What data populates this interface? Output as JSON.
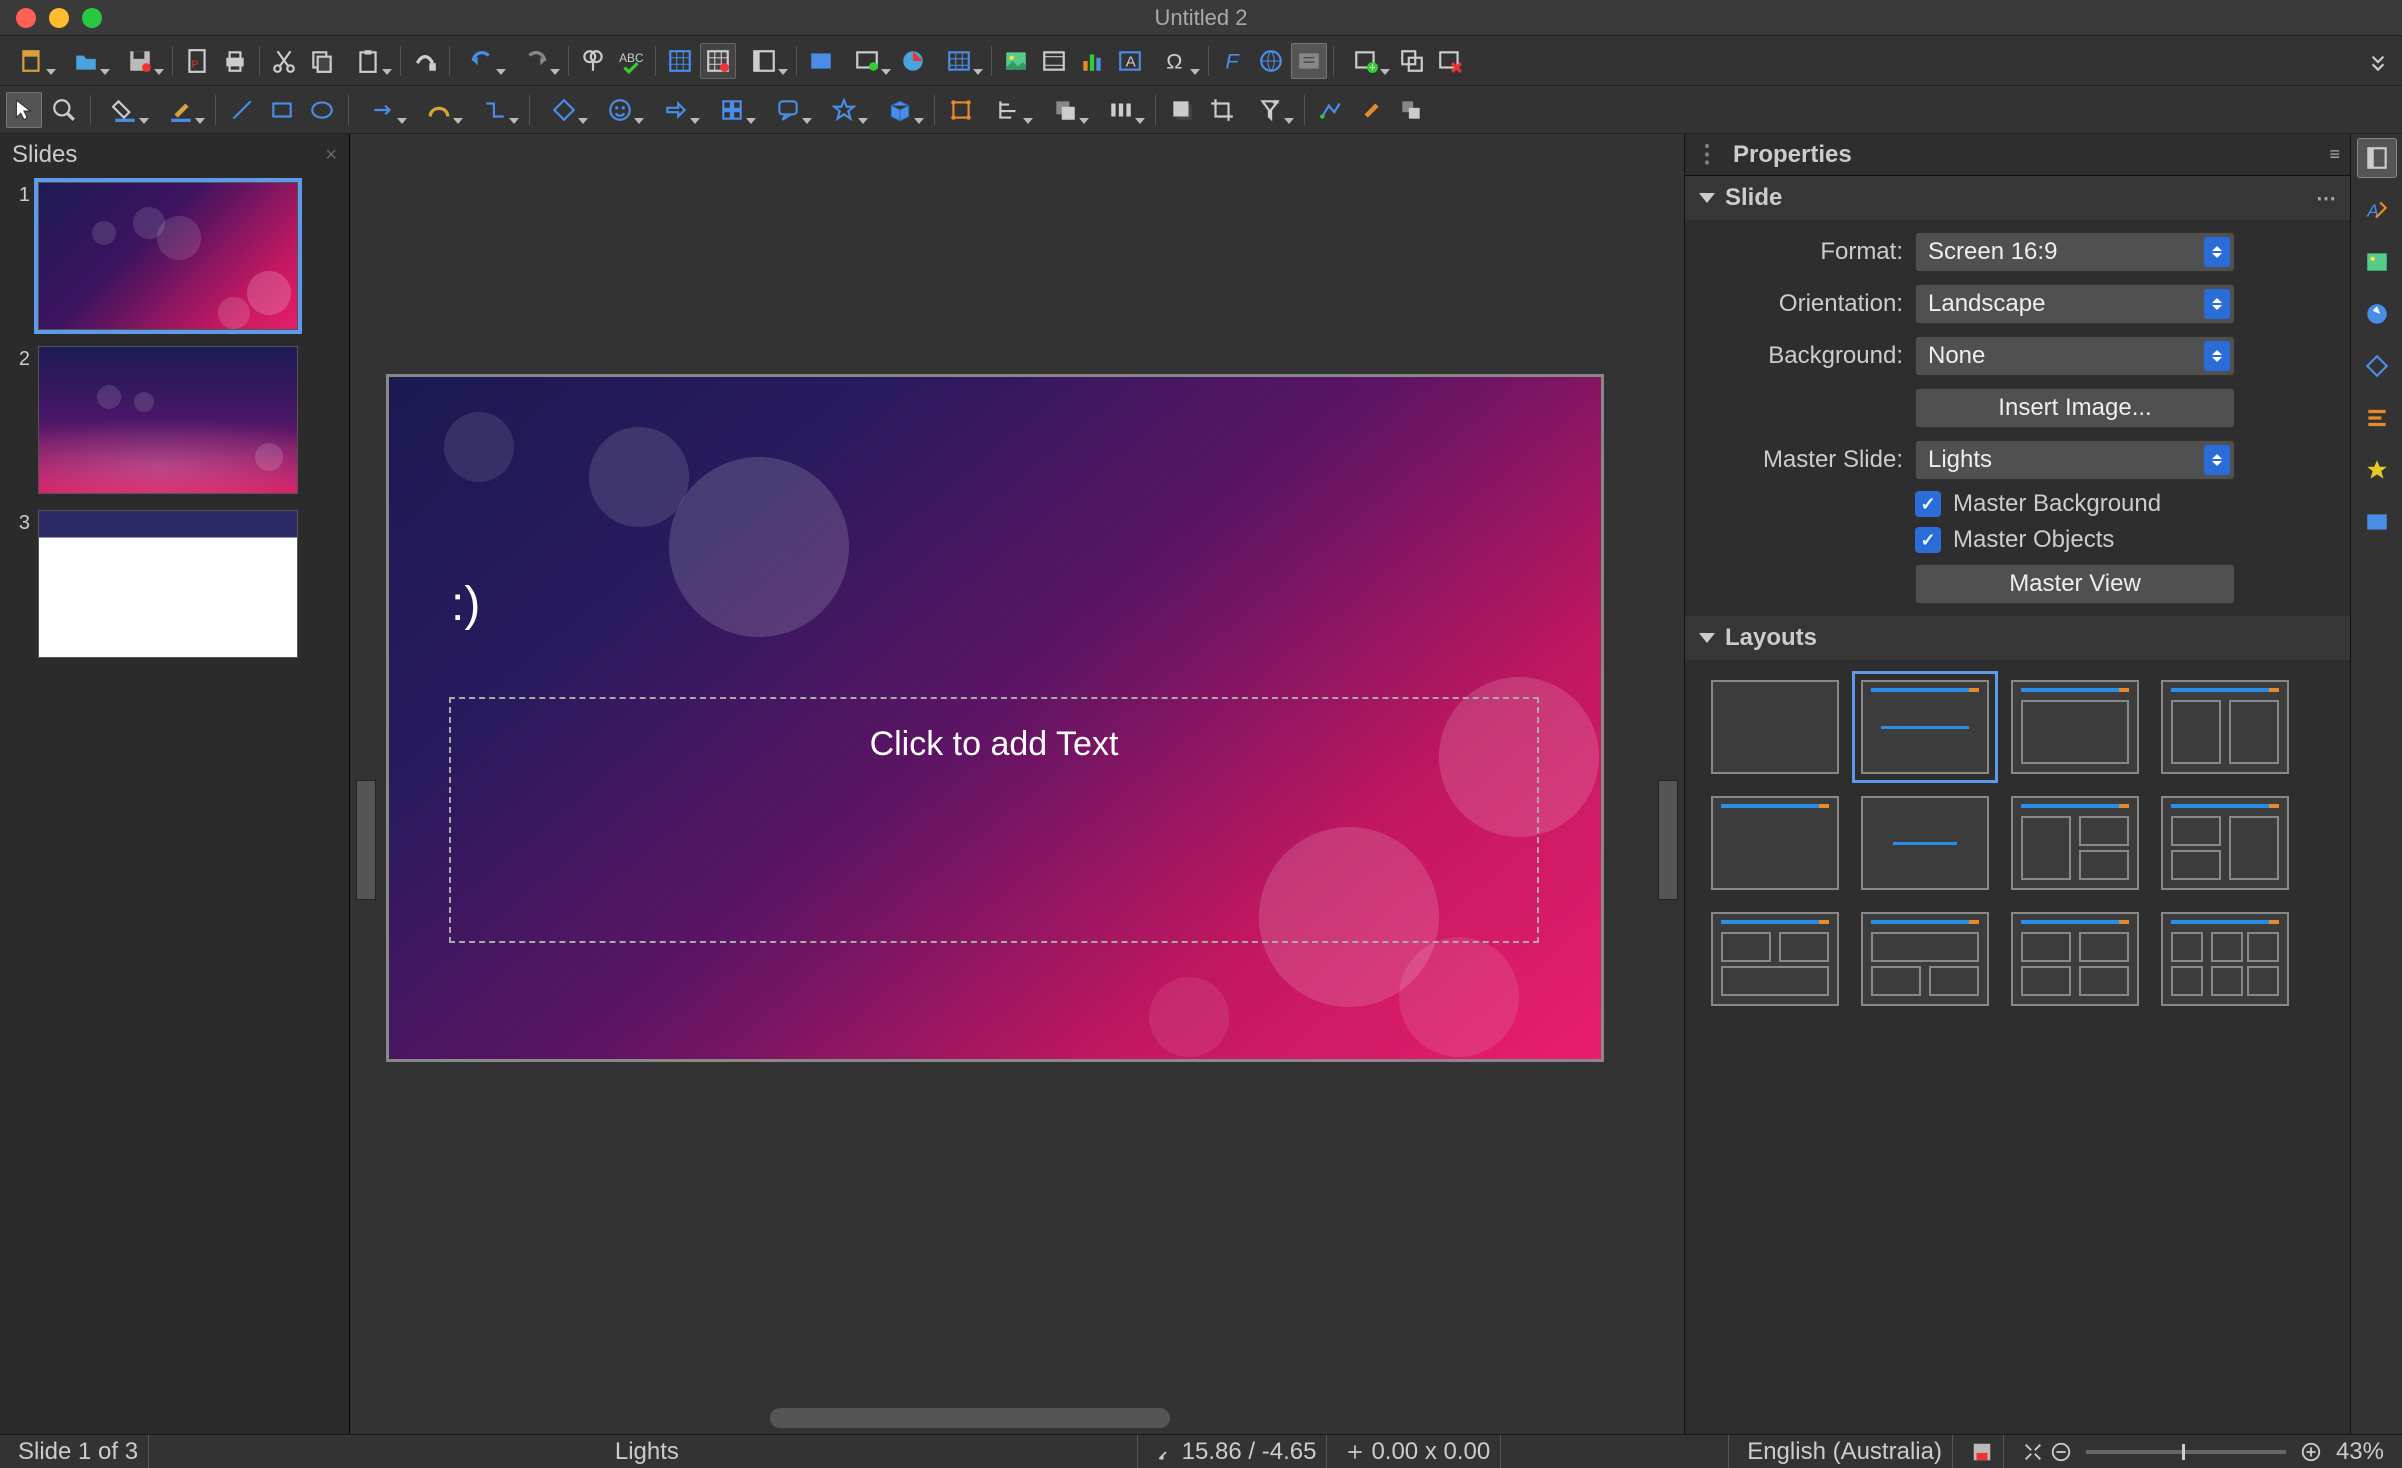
{
  "window": {
    "title": "Untitled 2"
  },
  "slidepanel": {
    "header": "Slides",
    "slides": [
      {
        "n": "1"
      },
      {
        "n": "2"
      },
      {
        "n": "3"
      }
    ]
  },
  "editor": {
    "title_text": ":)",
    "placeholder": "Click to add Text"
  },
  "properties": {
    "header": "Properties",
    "slide_section": "Slide",
    "format_label": "Format:",
    "format_value": "Screen 16:9",
    "orientation_label": "Orientation:",
    "orientation_value": "Landscape",
    "background_label": "Background:",
    "background_value": "None",
    "insert_image": "Insert Image...",
    "master_slide_label": "Master Slide:",
    "master_slide_value": "Lights",
    "master_background": "Master Background",
    "master_objects": "Master Objects",
    "master_view": "Master View",
    "layouts_section": "Layouts"
  },
  "status": {
    "slide_count": "Slide 1 of 3",
    "master": "Lights",
    "coords": "15.86 / -4.65",
    "size": "0.00 x 0.00",
    "language": "English (Australia)",
    "zoom": "43%"
  }
}
